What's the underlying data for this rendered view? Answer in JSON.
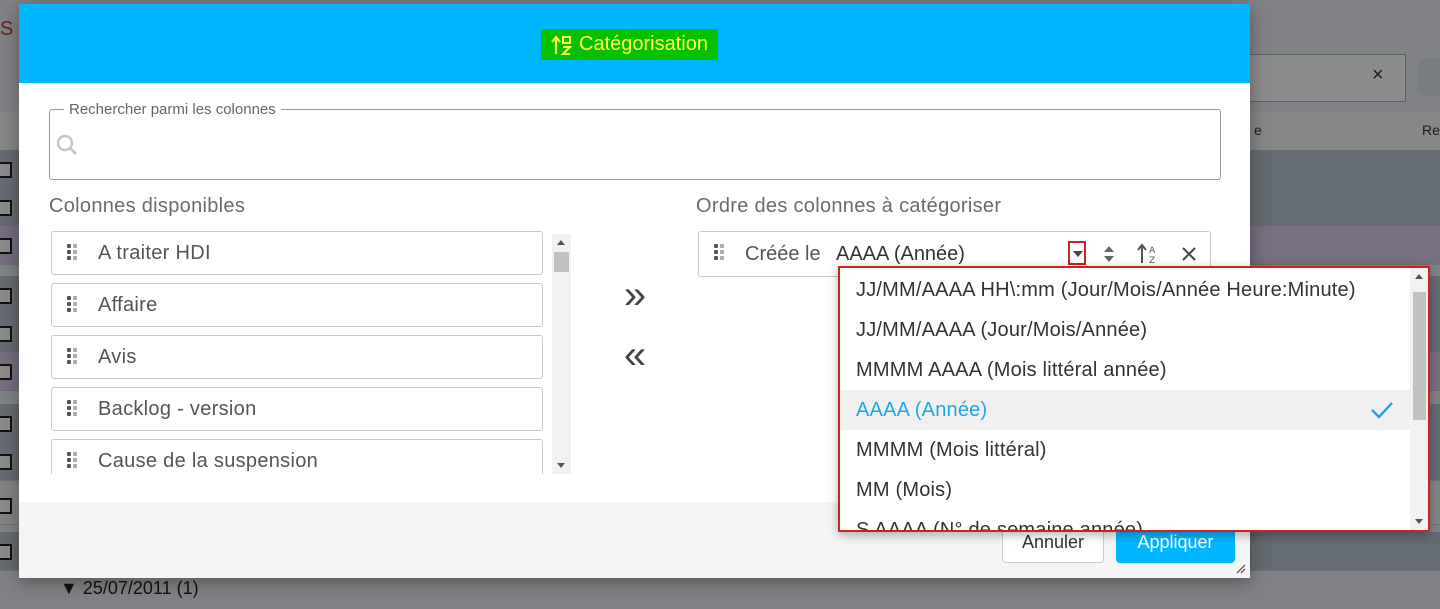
{
  "dialog": {
    "title": "Catégorisation",
    "search": {
      "legend": "Rechercher parmi les colonnes",
      "value": "",
      "placeholder": ""
    },
    "available": {
      "title": "Colonnes disponibles",
      "items": [
        "A traiter HDI",
        "Affaire",
        "Avis",
        "Backlog - version",
        "Cause de la suspension"
      ]
    },
    "ordered": {
      "title": "Ordre des colonnes à catégoriser",
      "items": [
        {
          "name": "Créée le",
          "format": "AAAA (Année)"
        }
      ]
    },
    "move_right": "»",
    "move_left": "«",
    "footer": {
      "cancel": "Annuler",
      "apply": "Appliquer"
    }
  },
  "format_dropdown": {
    "options": [
      "JJ/MM/AAAA HH\\:mm (Jour/Mois/Année Heure:Minute)",
      "JJ/MM/AAAA (Jour/Mois/Année)",
      "MMMM AAAA (Mois littéral année)",
      "AAAA (Année)",
      "MMMM (Mois littéral)",
      "MM (Mois)",
      "S AAAA (N° de semaine année)"
    ],
    "selected": "AAAA (Année)"
  },
  "background": {
    "header_right_1": "e",
    "header_right_2": "Re",
    "bottom_group": "25/07/2011 (1)",
    "clear_icon": "×"
  },
  "colors": {
    "header": "#00b7ff",
    "title_bg": "#07c003",
    "title_fg": "#ffff3b",
    "highlight": "#d21f1f",
    "selected_text": "#1ea7e6"
  }
}
